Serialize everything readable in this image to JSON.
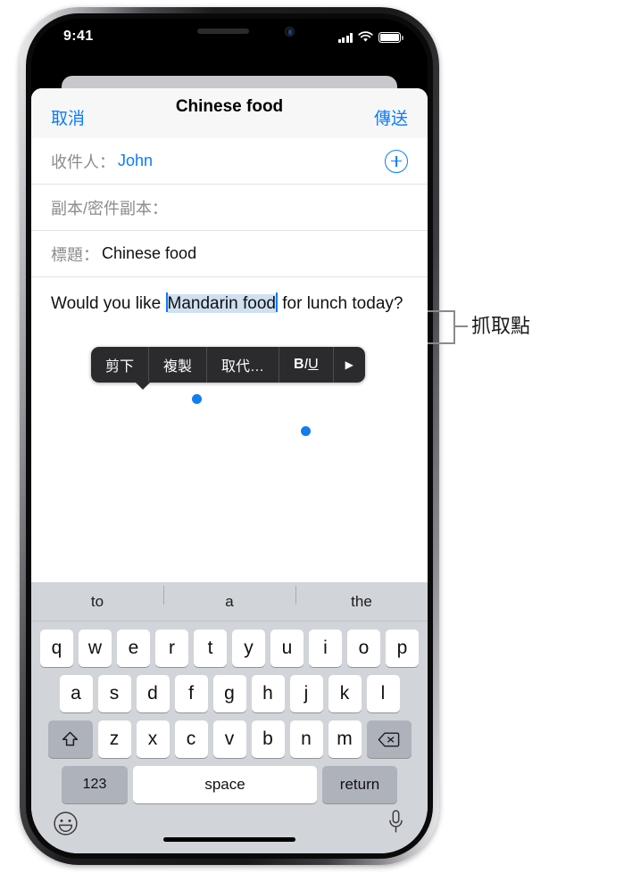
{
  "status_bar": {
    "time": "9:41",
    "cellular_icon": "signal-bars-icon",
    "wifi_icon": "wifi-icon",
    "battery_icon": "battery-full-icon"
  },
  "navbar": {
    "cancel_label": "取消",
    "title": "Chinese food",
    "send_label": "傳送"
  },
  "fields": {
    "to_label": "收件人：",
    "to_value": "John",
    "cc_label": "副本/密件副本：",
    "cc_value": "",
    "subject_label": "標題：",
    "subject_value": "Chinese food",
    "add_recipient_icon": "plus-circle-icon"
  },
  "body": {
    "before_selection": "Would you like ",
    "selection": "Mandarin food",
    "after_selection": " for lunch today?",
    "full_text": "Would you like Mandarin food for lunch today?"
  },
  "edit_menu": {
    "items": [
      {
        "label": "剪下",
        "name": "cut"
      },
      {
        "label": "複製",
        "name": "copy"
      },
      {
        "label": "取代…",
        "name": "replace"
      }
    ],
    "format": {
      "bold": "B",
      "italic": "I",
      "underline": "U"
    },
    "more_arrow": "▶"
  },
  "annotation": {
    "label": "抓取點"
  },
  "keyboard": {
    "predictions": [
      "to",
      "a",
      "the"
    ],
    "row1": [
      "q",
      "w",
      "e",
      "r",
      "t",
      "y",
      "u",
      "i",
      "o",
      "p"
    ],
    "row2": [
      "a",
      "s",
      "d",
      "f",
      "g",
      "h",
      "j",
      "k",
      "l"
    ],
    "row3": [
      "z",
      "x",
      "c",
      "v",
      "b",
      "n",
      "m"
    ],
    "shift_icon": "shift-arrow-icon",
    "delete_icon": "backspace-icon",
    "numbers_label": "123",
    "space_label": "space",
    "return_label": "return",
    "emoji_icon": "smiley-face-icon",
    "dictation_icon": "microphone-icon"
  },
  "colors": {
    "accent_blue": "#0a7cff",
    "selection_highlight": "#cfe0f1",
    "handle_blue": "#127cf0",
    "menu_background": "#2b2b2d",
    "keyboard_background": "#d1d4d9"
  }
}
